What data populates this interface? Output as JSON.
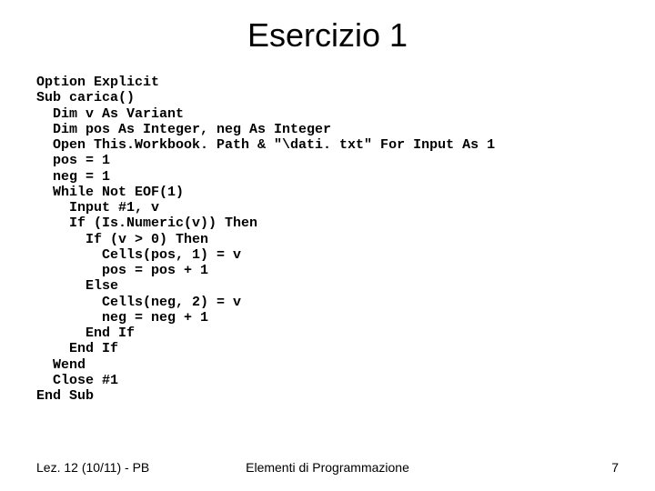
{
  "title": "Esercizio 1",
  "code": "Option Explicit\nSub carica()\n  Dim v As Variant\n  Dim pos As Integer, neg As Integer\n  Open This.Workbook. Path & \"\\dati. txt\" For Input As 1\n  pos = 1\n  neg = 1\n  While Not EOF(1)\n    Input #1, v\n    If (Is.Numeric(v)) Then\n      If (v > 0) Then\n        Cells(pos, 1) = v\n        pos = pos + 1\n      Else\n        Cells(neg, 2) = v\n        neg = neg + 1\n      End If\n    End If\n  Wend\n  Close #1\nEnd Sub",
  "footer": {
    "left": "Lez. 12  (10/11) - PB",
    "center": "Elementi di Programmazione",
    "right": "7"
  },
  "chart_data": null
}
